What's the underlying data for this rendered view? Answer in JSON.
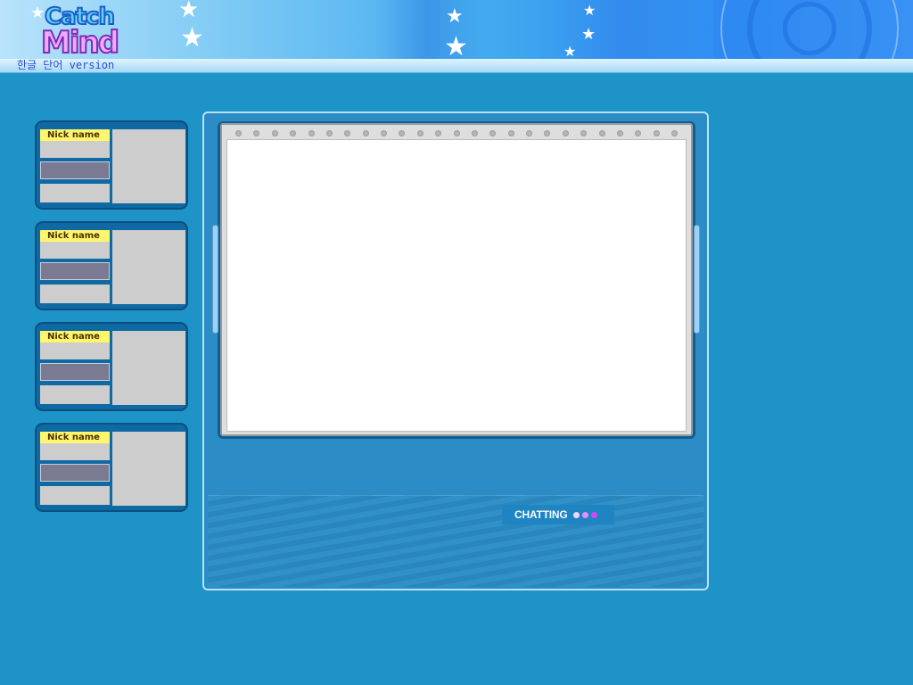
{
  "header": {
    "logo_line1": "Catch",
    "logo_line2": "Mind",
    "version_text": "한글 단어 version"
  },
  "players": [
    {
      "nick_label": "Nick name"
    },
    {
      "nick_label": "Nick name"
    },
    {
      "nick_label": "Nick name"
    },
    {
      "nick_label": "Nick name"
    }
  ],
  "chat": {
    "label": "CHATTING",
    "dot_colors": [
      "#f2d6ff",
      "#e88cff",
      "#d248f2"
    ]
  },
  "colors": {
    "background": "#1e93c8",
    "nick_tag": "#fff66e",
    "slot_highlight": "#7a7a92"
  }
}
